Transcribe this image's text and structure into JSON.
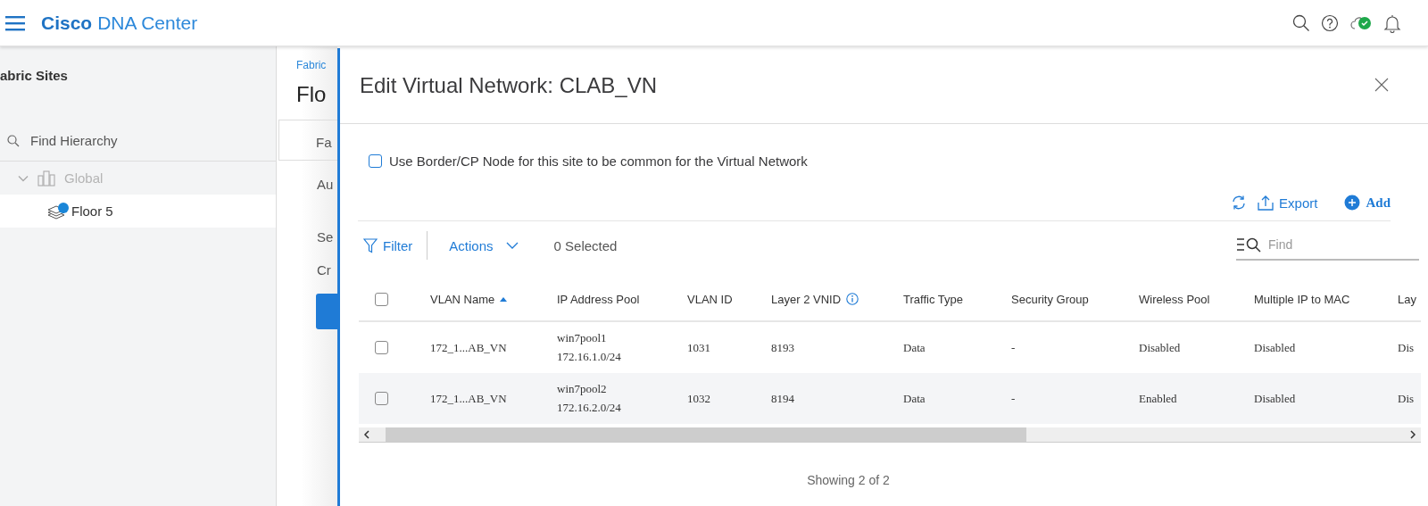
{
  "header": {
    "brand": "Cisco",
    "product": "DNA Center"
  },
  "sidebar": {
    "title": "abric Sites",
    "search": {
      "placeholder": "Find Hierarchy"
    },
    "tree": [
      {
        "label": "Global",
        "expanded": true,
        "selected": false,
        "children": [
          {
            "label": "Floor 5",
            "selected": true
          }
        ]
      }
    ]
  },
  "page": {
    "breadcrumb": "Fabric",
    "heading": "Flo",
    "tab": "Fa",
    "items": [
      "Au",
      "Se",
      "Cr"
    ]
  },
  "drawer": {
    "title": "Edit Virtual Network: CLAB_VN",
    "option": {
      "label": "Use Border/CP Node for this site to be common for the Virtual Network",
      "checked": false
    },
    "export": "Export",
    "add": "Add",
    "filter": "Filter",
    "actions": "Actions",
    "selected_count": "0 Selected",
    "find": {
      "placeholder": "Find"
    },
    "table": {
      "select_all": {
        "checked": false
      },
      "columns": [
        {
          "label": "VLAN Name",
          "sorted_ascending": true
        },
        {
          "label": "IP Address Pool"
        },
        {
          "label": "VLAN ID"
        },
        {
          "label": "Layer 2 VNID",
          "info": true
        },
        {
          "label": "Traffic Type"
        },
        {
          "label": "Security Group"
        },
        {
          "label": "Wireless Pool"
        },
        {
          "label": "Multiple IP to MAC"
        },
        {
          "label": "Lay"
        }
      ],
      "rows": [
        {
          "checked": false,
          "cells": [
            "172_1...AB_VN",
            {
              "pool": "win7pool1",
              "subnet": "172.16.1.0/24"
            },
            "1031",
            "8193",
            "Data",
            "-",
            "Disabled",
            "Disabled",
            "Dis"
          ]
        },
        {
          "checked": false,
          "cells": [
            "172_1...AB_VN",
            {
              "pool": "win7pool2",
              "subnet": "172.16.2.0/24"
            },
            "1032",
            "8194",
            "Data",
            "-",
            "Enabled",
            "Disabled",
            "Dis"
          ]
        }
      ]
    },
    "footer": "Showing 2 of 2"
  }
}
